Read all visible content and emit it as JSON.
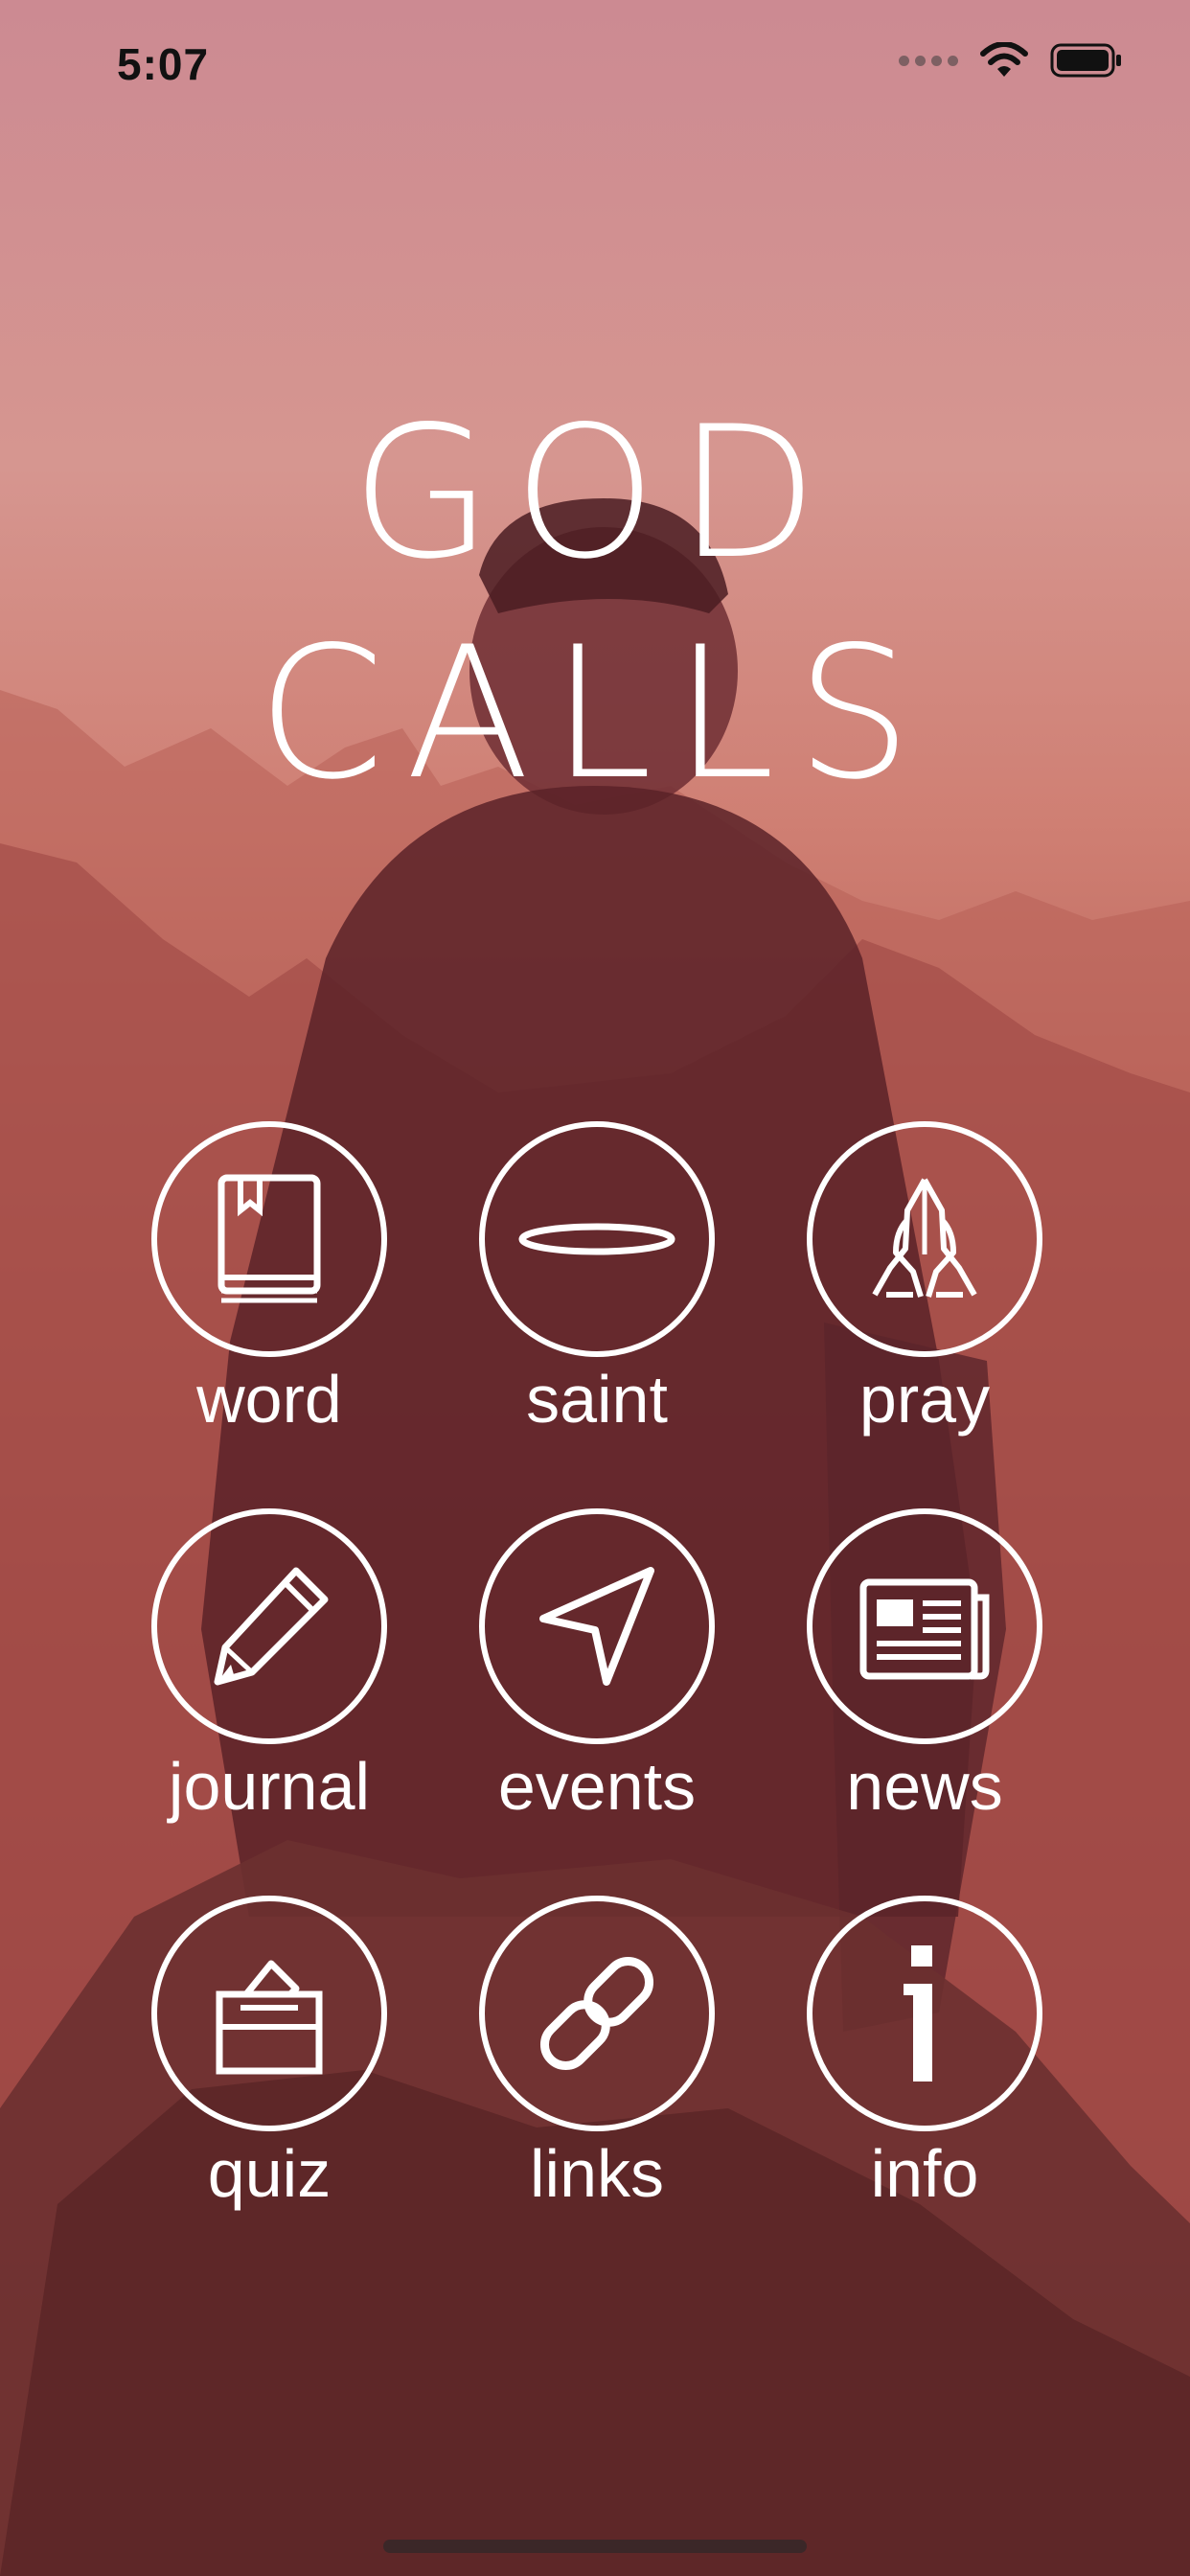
{
  "status_bar": {
    "time": "5:07"
  },
  "title": {
    "line1": "GOD",
    "line2": "CALLS"
  },
  "menu": {
    "items": [
      {
        "label": "word",
        "icon": "book-icon"
      },
      {
        "label": "saint",
        "icon": "halo-icon"
      },
      {
        "label": "pray",
        "icon": "praying-hands-icon"
      },
      {
        "label": "journal",
        "icon": "pencil-icon"
      },
      {
        "label": "events",
        "icon": "navigation-arrow-icon"
      },
      {
        "label": "news",
        "icon": "newspaper-icon"
      },
      {
        "label": "quiz",
        "icon": "ballot-box-icon"
      },
      {
        "label": "links",
        "icon": "link-icon"
      },
      {
        "label": "info",
        "icon": "info-icon"
      }
    ]
  },
  "colors": {
    "text": "#ffffff",
    "background_top": "#cc8a92",
    "background_bottom": "#6a2629"
  }
}
